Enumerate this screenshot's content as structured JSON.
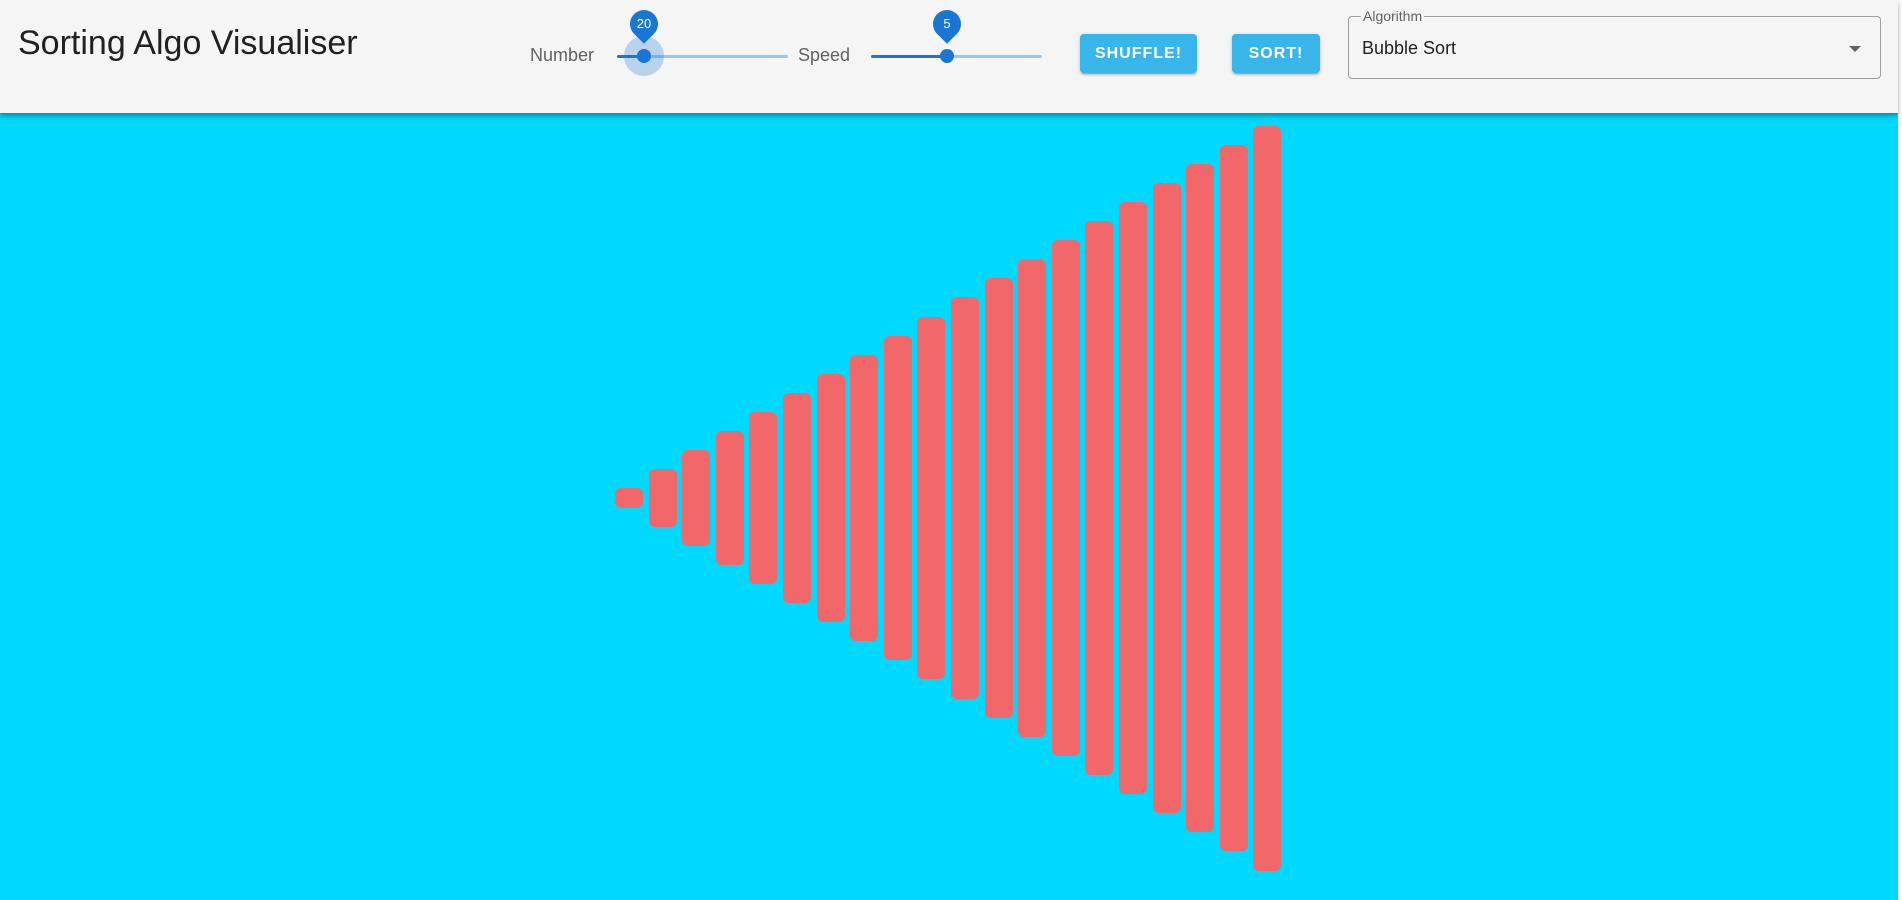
{
  "app": {
    "title": "Sorting Algo Visualiser"
  },
  "controls": {
    "number": {
      "label": "Number",
      "value": "20",
      "min": 5,
      "max": 100
    },
    "speed": {
      "label": "Speed",
      "value": "5",
      "min": 1,
      "max": 10
    },
    "shuffle_label": "SHUFFLE!",
    "sort_label": "SORT!",
    "algorithm": {
      "legend": "Algorithm",
      "value": "Bubble Sort"
    }
  },
  "colors": {
    "background": "#00d9ff",
    "bar": "#f2676a",
    "accent": "#1976d2",
    "button": "#38b6ea"
  },
  "array_values": [
    1,
    3,
    5,
    7,
    9,
    11,
    13,
    15,
    17,
    19,
    21,
    23,
    25,
    27,
    29,
    31,
    33,
    35,
    37,
    39
  ]
}
